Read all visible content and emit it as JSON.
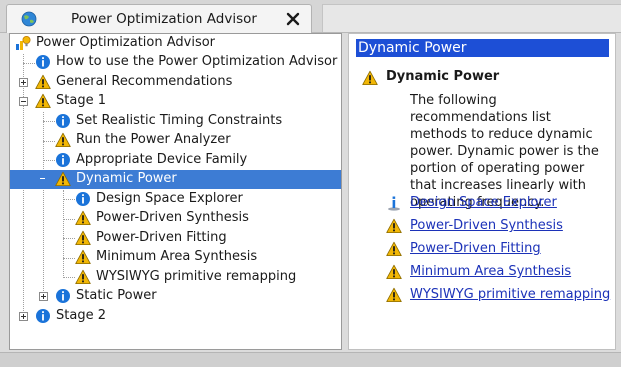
{
  "tab": {
    "title": "Power Optimization Advisor",
    "close_glyph": "✕"
  },
  "tree": {
    "rows": [
      {
        "label": "Power Optimization Advisor",
        "icon": "advisor-icon"
      },
      {
        "label": "How to use the Power Optimization Advisor",
        "icon": "info-icon"
      },
      {
        "label": "General Recommendations",
        "icon": "warning-icon"
      },
      {
        "label": "Stage 1",
        "icon": "warning-icon"
      },
      {
        "label": "Set Realistic Timing Constraints",
        "icon": "info-icon"
      },
      {
        "label": "Run the Power Analyzer",
        "icon": "warning-icon"
      },
      {
        "label": "Appropriate Device Family",
        "icon": "info-icon"
      },
      {
        "label": "Dynamic Power",
        "icon": "warning-icon",
        "selected": true
      },
      {
        "label": "Design Space Explorer",
        "icon": "info-icon"
      },
      {
        "label": "Power-Driven Synthesis",
        "icon": "warning-icon"
      },
      {
        "label": "Power-Driven Fitting",
        "icon": "warning-icon"
      },
      {
        "label": "Minimum Area Synthesis",
        "icon": "warning-icon"
      },
      {
        "label": "WYSIWYG primitive remapping",
        "icon": "warning-icon"
      },
      {
        "label": "Static Power",
        "icon": "info-icon"
      },
      {
        "label": "Stage 2",
        "icon": "info-icon"
      }
    ]
  },
  "detail": {
    "header": "Dynamic Power",
    "section_title": "Dynamic Power",
    "description": "The following recommendations list methods to reduce dynamic power. Dynamic power is the portion of operating power that increases linearly with operating frequency.",
    "links": [
      {
        "label": "Design Space Explorer",
        "icon": "info-icon"
      },
      {
        "label": "Power-Driven Synthesis",
        "icon": "warning-icon"
      },
      {
        "label": "Power-Driven Fitting",
        "icon": "warning-icon"
      },
      {
        "label": "Minimum Area Synthesis",
        "icon": "warning-icon"
      },
      {
        "label": "WYSIWYG primitive remapping",
        "icon": "warning-icon"
      }
    ]
  },
  "colors": {
    "selection": "#3d7cd4",
    "header_bg": "#1d4fd6",
    "link": "#1c32b8",
    "warning": "#f2b705",
    "info": "#1a73d9"
  }
}
